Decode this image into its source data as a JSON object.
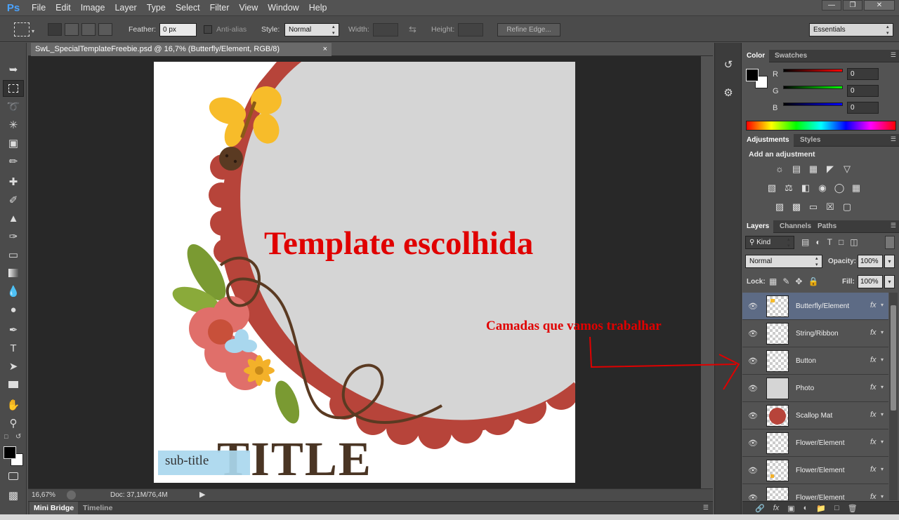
{
  "app": {
    "logo": "Ps"
  },
  "menu": [
    "File",
    "Edit",
    "Image",
    "Layer",
    "Type",
    "Select",
    "Filter",
    "View",
    "Window",
    "Help"
  ],
  "window_controls": {
    "minimize": "—",
    "restore": "❐",
    "close": "✕"
  },
  "options": {
    "feather_label": "Feather:",
    "feather_value": "0 px",
    "antialias_label": "Anti-alias",
    "style_label": "Style:",
    "style_value": "Normal",
    "width_label": "Width:",
    "height_label": "Height:",
    "refine_edge": "Refine Edge...",
    "workspace": "Essentials"
  },
  "document": {
    "tab_title": "SwL_SpecialTemplateFreebie.psd @ 16,7% (Butterfly/Element, RGB/8)",
    "tab_close": "×",
    "zoom": "16,67%",
    "doc_info": "Doc: 37,1M/76,4M"
  },
  "canvas": {
    "annotation_template": "Template escolhida",
    "annotation_layers": "Camadas que vamos trabalhar",
    "title_text": "TITLE",
    "subtitle_text": "sub-title"
  },
  "bottom_tabs": [
    "Mini Bridge",
    "Timeline"
  ],
  "color_panel": {
    "tabs": [
      "Color",
      "Swatches"
    ],
    "channels": [
      {
        "label": "R",
        "value": "0"
      },
      {
        "label": "G",
        "value": "0"
      },
      {
        "label": "B",
        "value": "0"
      }
    ]
  },
  "adjustments_panel": {
    "tabs": [
      "Adjustments",
      "Styles"
    ],
    "heading": "Add an adjustment"
  },
  "layers_panel": {
    "tabs": [
      "Layers",
      "Channels",
      "Paths"
    ],
    "kind_filter": "Kind",
    "blend_mode": "Normal",
    "opacity_label": "Opacity:",
    "opacity_value": "100%",
    "lock_label": "Lock:",
    "fill_label": "Fill:",
    "fill_value": "100%",
    "layers": [
      {
        "name": "Butterfly/Element",
        "fx": "fx",
        "selected": true
      },
      {
        "name": "String/Ribbon",
        "fx": "fx"
      },
      {
        "name": "Button",
        "fx": "fx"
      },
      {
        "name": "Photo",
        "fx": "fx"
      },
      {
        "name": "Scallop Mat",
        "fx": "fx"
      },
      {
        "name": "Flower/Element",
        "fx": "fx"
      },
      {
        "name": "Flower/Element",
        "fx": "fx"
      },
      {
        "name": "Flower/Element",
        "fx": "fx"
      }
    ]
  },
  "colors": {
    "accent_red": "#e00000",
    "scallop": "#b7443a",
    "title_brown": "#4a3524",
    "photo_gray": "#d5d5d5",
    "selected_layer": "#5d6b85"
  }
}
